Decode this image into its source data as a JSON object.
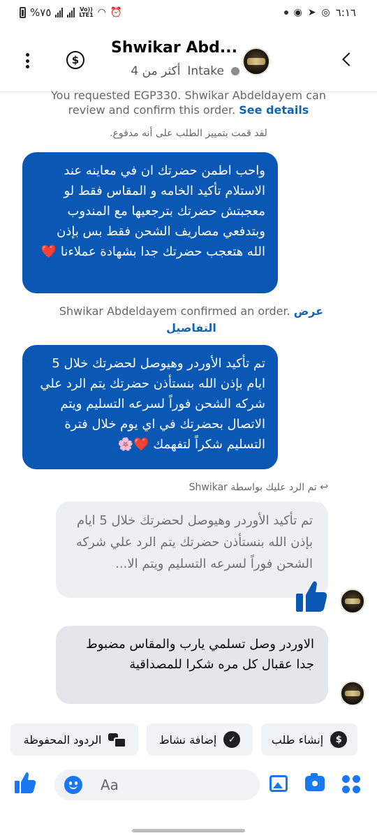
{
  "status_bar": {
    "battery": "%٧٥",
    "network": "Vo)) LTE1",
    "time": "٦:١٦"
  },
  "header": {
    "title": "Shwikar Abd...",
    "subtitle_status": "Intake",
    "subtitle_count": "أكثر من 4"
  },
  "messages": {
    "payment_request": {
      "text": "You requested EGP330. Shwikar Abdeldayem can review and confirm this order.",
      "link": "See details"
    },
    "marked_paid": "لقد قمت بتمييز الطلب على أنه مدفوع.",
    "sent_1": "واحب اطمن حضرتك ان في معاينه عند الاستلام تأكيد الخامه و المقاس  فقط لو معجبتش حضرتك بترجعيها مع المندوب وبتدفعي مصاريف الشحن فقط بس بإذن الله هتعجب حضرتك جدا بشهادة عملاءنا",
    "sent_1_emoji": "❤️",
    "confirmed": {
      "text": "Shwikar Abdeldayem confirmed an order.",
      "link": "عرض التفاصيل"
    },
    "sent_2": "تم تأكيد الأوردر وهيوصل لحضرتك خلال 5 ايام بإذن الله بنستأذن حضرتك يتم الرد علي شركه الشحن فوراً لسرعه التسليم ويتم الاتصال بحضرتك في اي يوم خلال فترة التسليم شكراً لتفهمك",
    "sent_2_emoji": "❤️🌸",
    "reply_label": "تم الرد عليك بواسطة Shwikar",
    "quoted_text": "تم تأكيد الأوردر وهيوصل لحضرتك خلال 5 ايام بإذن الله بنستأذن حضرتك يتم الرد علي شركه الشحن فوراً لسرعه التسليم ويتم الا...",
    "received": "الاوردر وصل تسلمي يارب والمقاس مضبوط جدا عقبال كل مره شكرا للمصداقية"
  },
  "quick_actions": [
    {
      "label": "إنشاء طلب",
      "icon": "dollar-circle-icon"
    },
    {
      "label": "إضافة نشاط",
      "icon": "check-circle-icon"
    },
    {
      "label": "الردود المحفوظة",
      "icon": "chat-bubbles-icon"
    }
  ],
  "composer": {
    "placeholder": "Aa"
  },
  "colors": {
    "sent_bubble": "#0a58b4",
    "received_bubble": "#e4e6eb",
    "accent": "#1877f2"
  }
}
